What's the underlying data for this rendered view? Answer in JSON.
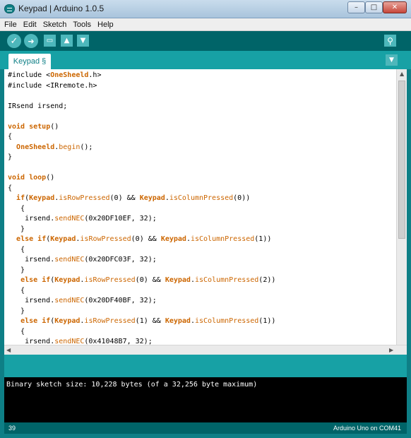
{
  "window": {
    "title": "Keypad | Arduino 1.0.5",
    "min_glyph": "–",
    "max_glyph": "□",
    "close_glyph": "✕"
  },
  "menu": [
    "File",
    "Edit",
    "Sketch",
    "Tools",
    "Help"
  ],
  "toolbar": {
    "verify_icon": "check-icon",
    "verify_glyph": "✓",
    "upload_icon": "arrow-right-icon",
    "upload_glyph": "➜",
    "new_icon": "new-document-icon",
    "new_glyph": "▭",
    "open_icon": "upload-arrow-icon",
    "open_glyph": "▲",
    "save_icon": "download-arrow-icon",
    "save_glyph": "▼",
    "serial_icon": "magnifier-icon",
    "serial_glyph": "⚲"
  },
  "tab": {
    "label": "Keypad §",
    "menu_glyph": "▼"
  },
  "code_lines": [
    "#include <OneSheeld.h>",
    "#include <IRremote.h>",
    "",
    "IRsend irsend;",
    "",
    "void setup()",
    "{",
    "  OneSheeld.begin();",
    "}",
    "",
    "void loop()",
    "{",
    "  if(Keypad.isRowPressed(0) && Keypad.isColumnPressed(0))",
    "   {",
    "    irsend.sendNEC(0x20DF10EF, 32);",
    "   }",
    "  else if(Keypad.isRowPressed(0) && Keypad.isColumnPressed(1))",
    "   {",
    "    irsend.sendNEC(0x20DFC03F, 32);",
    "   }",
    "   else if(Keypad.isRowPressed(0) && Keypad.isColumnPressed(2))",
    "   {",
    "    irsend.sendNEC(0x20DF40BF, 32);",
    "   }",
    "   else if(Keypad.isRowPressed(1) && Keypad.isColumnPressed(1))",
    "   {",
    "    irsend.sendNEC(0x41048B7, 32);"
  ],
  "colors": {
    "keyword": "#cc6600",
    "teal_dark": "#006468",
    "teal_mid": "#17a1a5"
  },
  "console": {
    "message": "Binary sketch size: 10,228 bytes (of a 32,256 byte maximum)"
  },
  "footer": {
    "line_number": "39",
    "board": "Arduino Uno on COM41"
  }
}
